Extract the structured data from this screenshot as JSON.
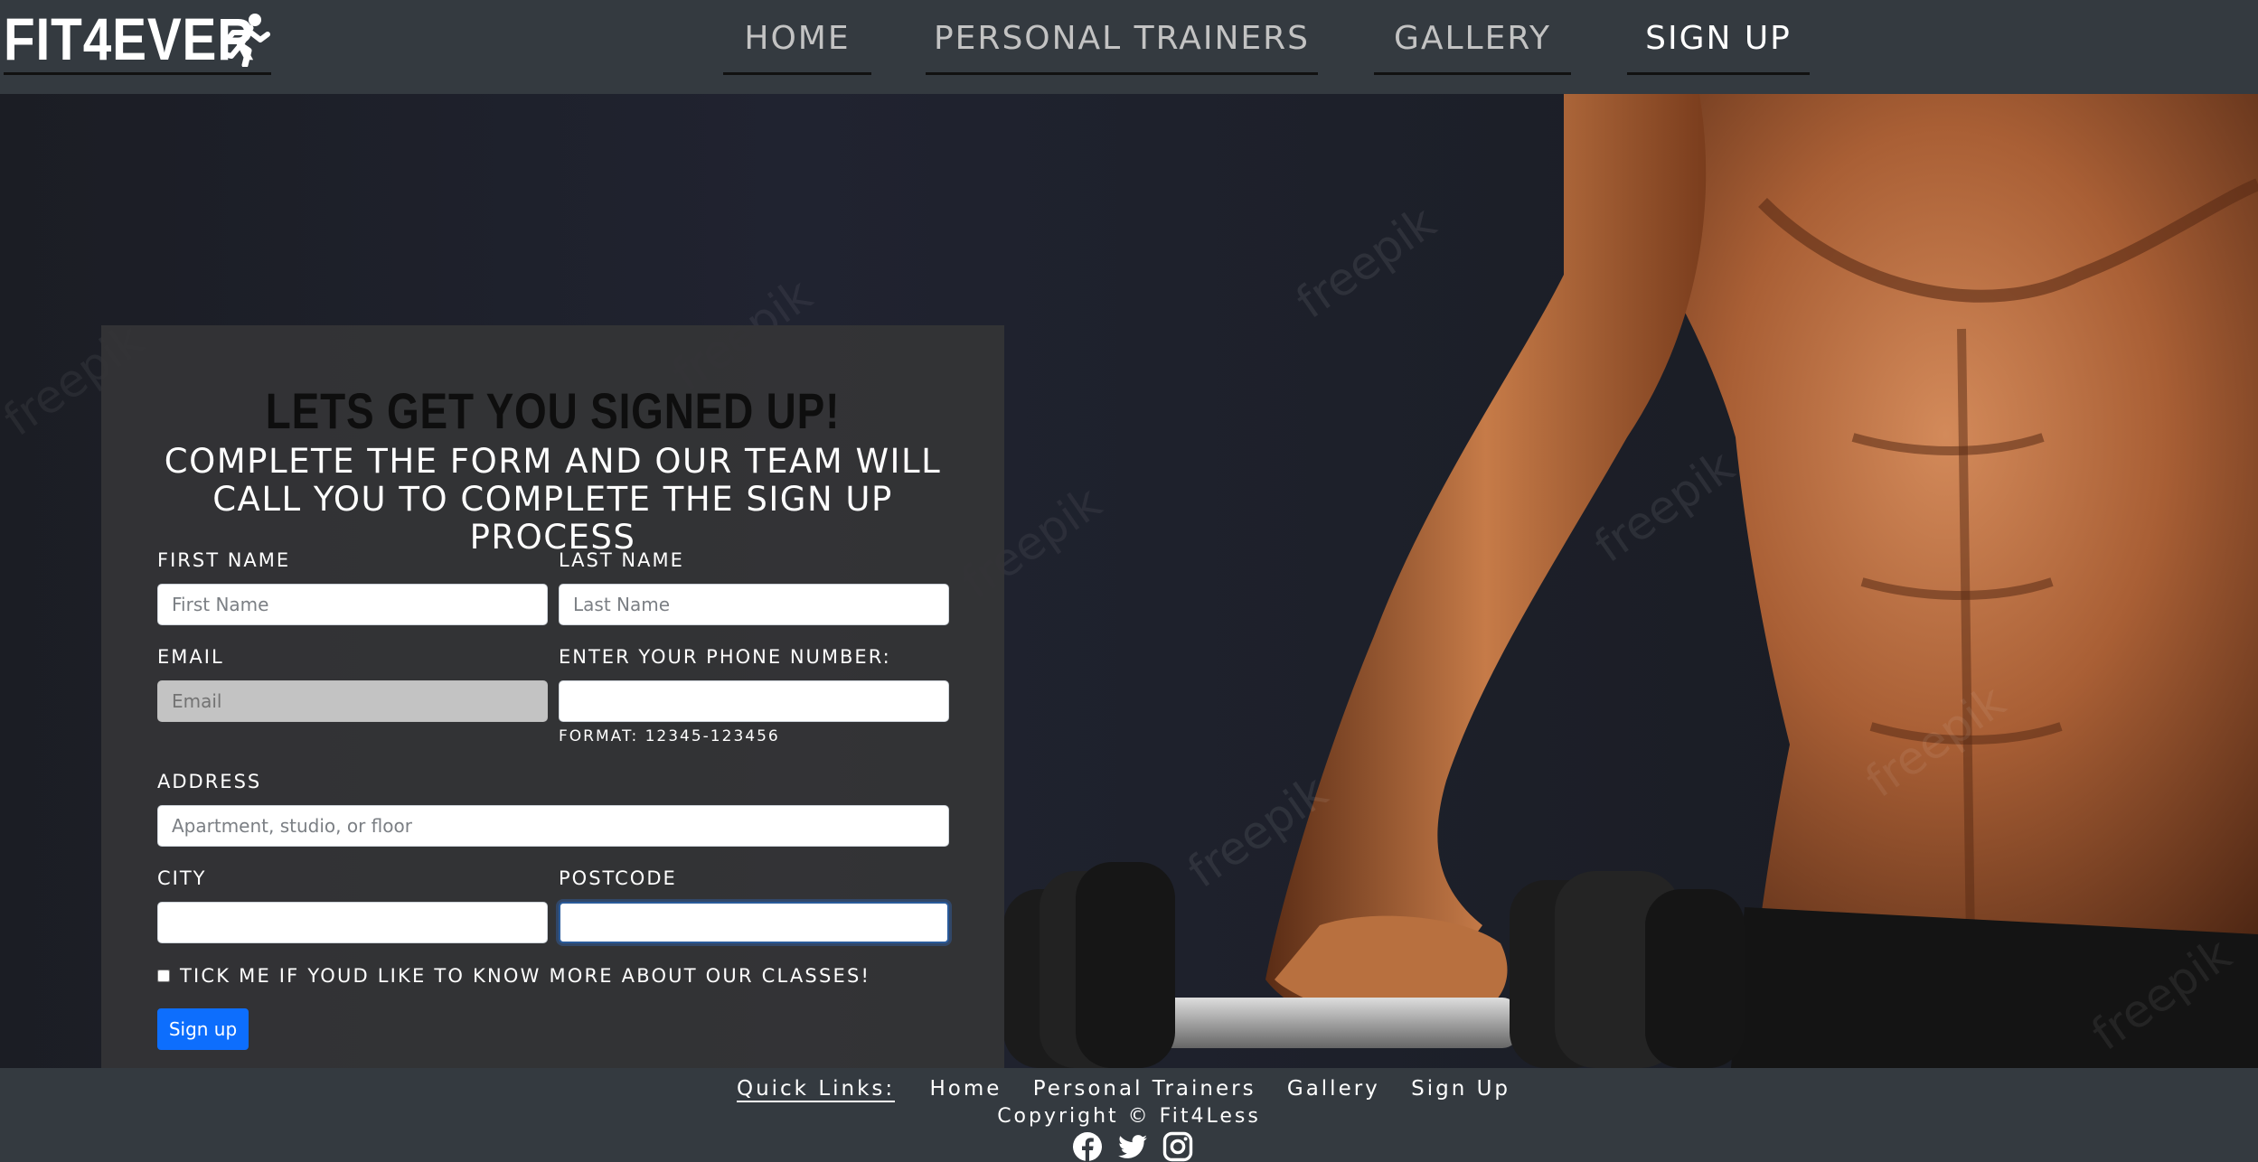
{
  "brand": {
    "name": "FIT4EVER",
    "icon": "running-man-icon"
  },
  "nav": {
    "links": [
      {
        "label": "HOME",
        "active": false
      },
      {
        "label": "PERSONAL TRAINERS",
        "active": false
      },
      {
        "label": "GALLERY",
        "active": false
      },
      {
        "label": "SIGN UP",
        "active": true
      }
    ]
  },
  "hero": {
    "watermark": "freepik"
  },
  "form": {
    "title": "LETS GET YOU SIGNED UP!",
    "subtitle": "COMPLETE THE FORM AND OUR TEAM WILL CALL YOU TO COMPLETE THE SIGN UP PROCESS",
    "first_name": {
      "label": "FIRST NAME",
      "placeholder": "First Name",
      "value": ""
    },
    "last_name": {
      "label": "LAST NAME",
      "placeholder": "Last Name",
      "value": ""
    },
    "email": {
      "label": "EMAIL",
      "placeholder": "Email",
      "value": ""
    },
    "phone": {
      "label": "ENTER YOUR PHONE NUMBER:",
      "placeholder": "",
      "value": "",
      "help": "FORMAT: 12345-123456"
    },
    "address": {
      "label": "ADDRESS",
      "placeholder": "Apartment, studio, or floor",
      "value": ""
    },
    "city": {
      "label": "CITY",
      "placeholder": "",
      "value": ""
    },
    "postcode": {
      "label": "POSTCODE",
      "placeholder": "",
      "value": ""
    },
    "classes_checkbox": {
      "label": "TICK ME IF YOUD LIKE TO KNOW MORE ABOUT OUR CLASSES!",
      "checked": false
    },
    "submit_label": "Sign up"
  },
  "footer": {
    "quick_links_title": "Quick Links:",
    "links": [
      "Home",
      "Personal Trainers",
      "Gallery",
      "Sign Up"
    ],
    "copyright": "Copyright © Fit4Less",
    "socials": [
      "facebook-icon",
      "twitter-icon",
      "instagram-icon"
    ]
  },
  "colors": {
    "navbar_bg": "#343a40",
    "card_bg": "#343436",
    "button_primary": "#0d6efd",
    "disabled_input": "#c3c3c3",
    "skin_tone": "#b0683e"
  }
}
